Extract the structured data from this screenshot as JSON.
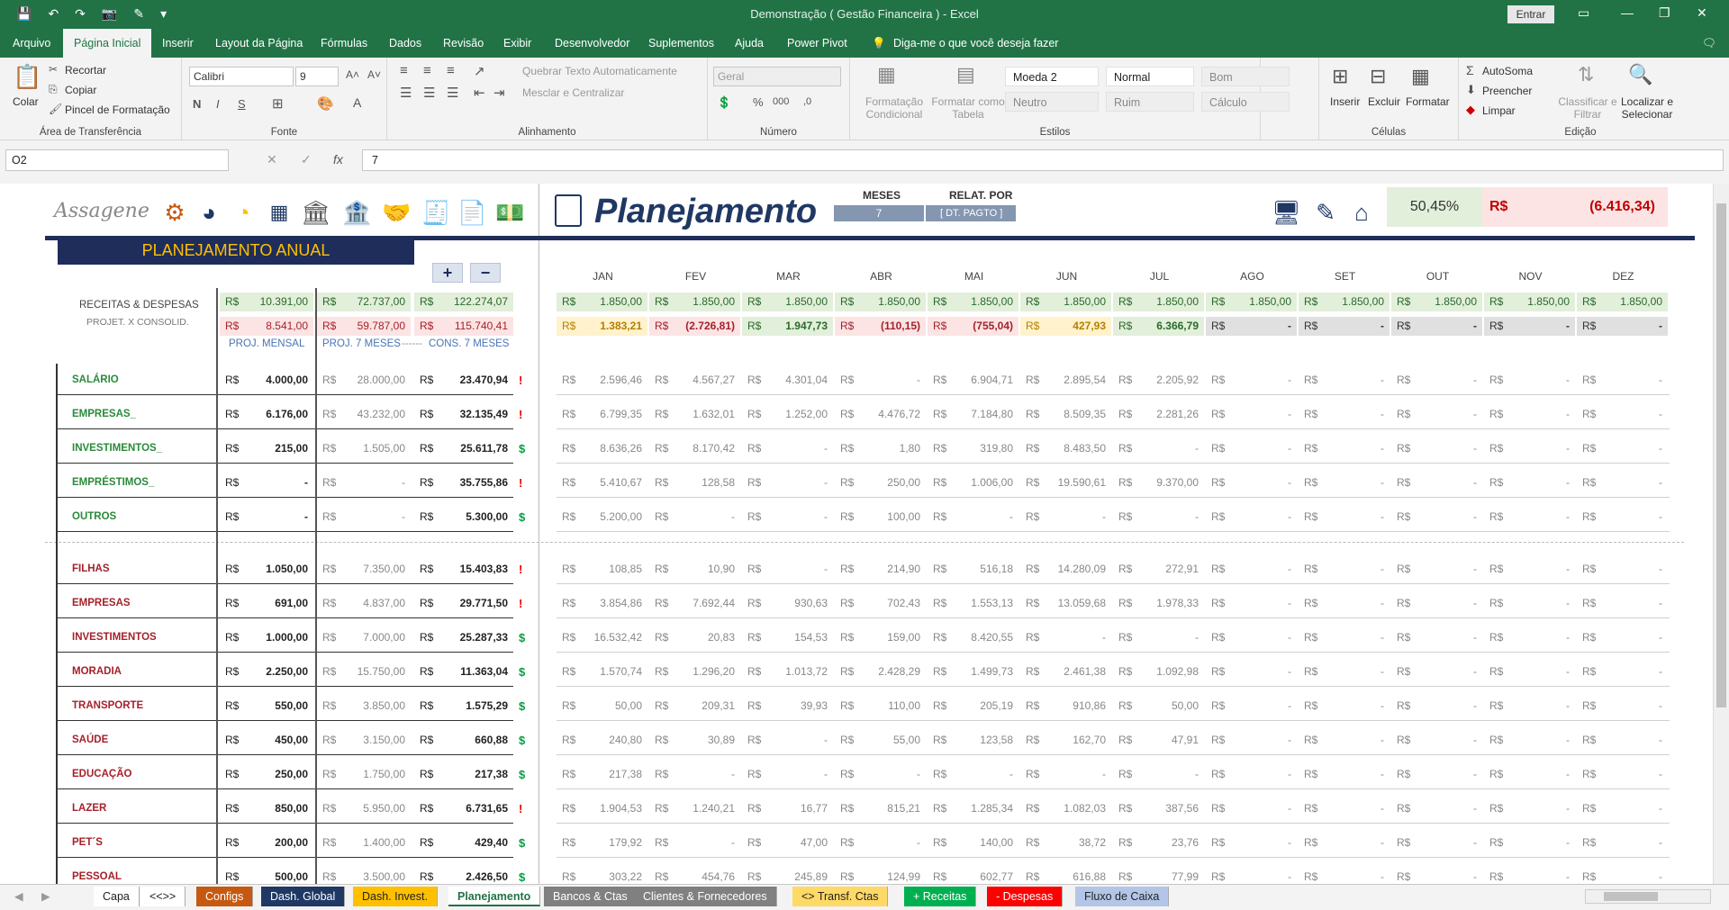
{
  "window": {
    "title": "Demonstração ( Gestão Financeira )  -  Excel",
    "signin": "Entrar"
  },
  "ribbon_tabs": [
    "Arquivo",
    "Página Inicial",
    "Inserir",
    "Layout da Página",
    "Fórmulas",
    "Dados",
    "Revisão",
    "Exibir",
    "Desenvolvedor",
    "Suplementos",
    "Ajuda",
    "Power Pivot"
  ],
  "tell_me": "Diga-me o que você deseja fazer",
  "ribbon": {
    "clipboard": {
      "paste": "Colar",
      "cut": "Recortar",
      "copy": "Copiar",
      "painter": "Pincel de Formatação",
      "label": "Área de Transferência"
    },
    "font": {
      "name": "Calibri",
      "size": "9",
      "label": "Fonte"
    },
    "align": {
      "wrap": "Quebrar Texto Automaticamente",
      "merge": "Mesclar e Centralizar",
      "label": "Alinhamento"
    },
    "number": {
      "format": "Geral",
      "label": "Número"
    },
    "styles": {
      "cond": "Formatação Condicional",
      "table": "Formatar como Tabela",
      "cells": [
        "Moeda 2",
        "Normal",
        "Bom",
        "Neutro",
        "Ruim",
        "Cálculo"
      ],
      "label": "Estilos"
    },
    "cells": {
      "insert": "Inserir",
      "delete": "Excluir",
      "format": "Formatar",
      "label": "Células"
    },
    "edit": {
      "autosum": "AutoSoma",
      "fill": "Preencher",
      "clear": "Limpar",
      "sort": "Classificar e Filtrar",
      "find": "Localizar e Selecionar",
      "label": "Edição"
    }
  },
  "formula_bar": {
    "cell": "O2",
    "value": "7"
  },
  "dashboard": {
    "logo": "Assagene",
    "title": "Planejamento",
    "meses_label": "MESES",
    "meses_value": "7",
    "relat_label": "RELAT. POR",
    "relat_value": "[ DT. PAGTO ]",
    "pct": "50,45%",
    "currency": "R$",
    "balance": "(6.416,34)",
    "panel_title": "PLANEJAMENTO ANUAL",
    "plus": "+",
    "minus": "−",
    "rd_label_1": "RECEITAS & DESPESAS",
    "rd_label_2": "PROJET. X CONSOLID.",
    "sub_labels": [
      "PROJ. MENSAL",
      "PROJ. 7 MESES",
      "------",
      "CONS. 7 MESES"
    ]
  },
  "months": [
    "JAN",
    "FEV",
    "MAR",
    "ABR",
    "MAI",
    "JUN",
    "JUL",
    "AGO",
    "SET",
    "OUT",
    "NOV",
    "DEZ"
  ],
  "summary": {
    "receitas": [
      "10.391,00",
      "72.737,00",
      "122.274,07"
    ],
    "despesas": [
      "8.541,00",
      "59.787,00",
      "115.740,41"
    ],
    "month_receitas": [
      "1.850,00",
      "1.850,00",
      "1.850,00",
      "1.850,00",
      "1.850,00",
      "1.850,00",
      "1.850,00",
      "1.850,00",
      "1.850,00",
      "1.850,00",
      "1.850,00",
      "1.850,00"
    ],
    "month_saldo": [
      "1.383,21",
      "(2.726,81)",
      "1.947,73",
      "(110,15)",
      "(755,04)",
      "427,93",
      "6.366,79",
      "-",
      "-",
      "-",
      "-",
      "-"
    ]
  },
  "rows": [
    {
      "label": "SALÁRIO",
      "type": "rec",
      "proj": "4.000,00",
      "proj7": "28.000,00",
      "cons7": "23.470,94",
      "flag": "!",
      "m": [
        "2.596,46",
        "4.567,27",
        "4.301,04",
        "-",
        "6.904,71",
        "2.895,54",
        "2.205,92",
        "-",
        "-",
        "-",
        "-",
        "-"
      ]
    },
    {
      "label": "EMPRESAS_",
      "type": "rec",
      "proj": "6.176,00",
      "proj7": "43.232,00",
      "cons7": "32.135,49",
      "flag": "!",
      "m": [
        "6.799,35",
        "1.632,01",
        "1.252,00",
        "4.476,72",
        "7.184,80",
        "8.509,35",
        "2.281,26",
        "-",
        "-",
        "-",
        "-",
        "-"
      ]
    },
    {
      "label": "INVESTIMENTOS_",
      "type": "rec",
      "proj": "215,00",
      "proj7": "1.505,00",
      "cons7": "25.611,78",
      "flag": "$",
      "m": [
        "8.636,26",
        "8.170,42",
        "-",
        "1,80",
        "319,80",
        "8.483,50",
        "-",
        "-",
        "-",
        "-",
        "-",
        "-"
      ]
    },
    {
      "label": "EMPRÉSTIMOS_",
      "type": "rec",
      "proj": "-",
      "proj7": "-",
      "cons7": "35.755,86",
      "flag": "!",
      "m": [
        "5.410,67",
        "128,58",
        "-",
        "250,00",
        "1.006,00",
        "19.590,61",
        "9.370,00",
        "-",
        "-",
        "-",
        "-",
        "-"
      ]
    },
    {
      "label": "OUTROS",
      "type": "rec",
      "proj": "-",
      "proj7": "-",
      "cons7": "5.300,00",
      "flag": "$",
      "m": [
        "5.200,00",
        "-",
        "-",
        "100,00",
        "-",
        "-",
        "-",
        "-",
        "-",
        "-",
        "-",
        "-"
      ]
    },
    {
      "label": "FILHAS",
      "type": "desp",
      "proj": "1.050,00",
      "proj7": "7.350,00",
      "cons7": "15.403,83",
      "flag": "!",
      "m": [
        "108,85",
        "10,90",
        "-",
        "214,90",
        "516,18",
        "14.280,09",
        "272,91",
        "-",
        "-",
        "-",
        "-",
        "-"
      ]
    },
    {
      "label": "EMPRESAS",
      "type": "desp",
      "proj": "691,00",
      "proj7": "4.837,00",
      "cons7": "29.771,50",
      "flag": "!",
      "m": [
        "3.854,86",
        "7.692,44",
        "930,63",
        "702,43",
        "1.553,13",
        "13.059,68",
        "1.978,33",
        "-",
        "-",
        "-",
        "-",
        "-"
      ]
    },
    {
      "label": "INVESTIMENTOS",
      "type": "desp",
      "proj": "1.000,00",
      "proj7": "7.000,00",
      "cons7": "25.287,33",
      "flag": "$",
      "m": [
        "16.532,42",
        "20,83",
        "154,53",
        "159,00",
        "8.420,55",
        "-",
        "-",
        "-",
        "-",
        "-",
        "-",
        "-"
      ]
    },
    {
      "label": "MORADIA",
      "type": "desp",
      "proj": "2.250,00",
      "proj7": "15.750,00",
      "cons7": "11.363,04",
      "flag": "$",
      "m": [
        "1.570,74",
        "1.296,20",
        "1.013,72",
        "2.428,29",
        "1.499,73",
        "2.461,38",
        "1.092,98",
        "-",
        "-",
        "-",
        "-",
        "-"
      ]
    },
    {
      "label": "TRANSPORTE",
      "type": "desp",
      "proj": "550,00",
      "proj7": "3.850,00",
      "cons7": "1.575,29",
      "flag": "$",
      "m": [
        "50,00",
        "209,31",
        "39,93",
        "110,00",
        "205,19",
        "910,86",
        "50,00",
        "-",
        "-",
        "-",
        "-",
        "-"
      ]
    },
    {
      "label": "SAÚDE",
      "type": "desp",
      "proj": "450,00",
      "proj7": "3.150,00",
      "cons7": "660,88",
      "flag": "$",
      "m": [
        "240,80",
        "30,89",
        "-",
        "55,00",
        "123,58",
        "162,70",
        "47,91",
        "-",
        "-",
        "-",
        "-",
        "-"
      ]
    },
    {
      "label": "EDUCAÇÃO",
      "type": "desp",
      "proj": "250,00",
      "proj7": "1.750,00",
      "cons7": "217,38",
      "flag": "$",
      "m": [
        "217,38",
        "-",
        "-",
        "-",
        "-",
        "-",
        "-",
        "-",
        "-",
        "-",
        "-",
        "-"
      ]
    },
    {
      "label": "LAZER",
      "type": "desp",
      "proj": "850,00",
      "proj7": "5.950,00",
      "cons7": "6.731,65",
      "flag": "!",
      "m": [
        "1.904,53",
        "1.240,21",
        "16,77",
        "815,21",
        "1.285,34",
        "1.082,03",
        "387,56",
        "-",
        "-",
        "-",
        "-",
        "-"
      ]
    },
    {
      "label": "PET´S",
      "type": "desp",
      "proj": "200,00",
      "proj7": "1.400,00",
      "cons7": "429,40",
      "flag": "$",
      "m": [
        "179,92",
        "-",
        "47,00",
        "-",
        "140,00",
        "38,72",
        "23,76",
        "-",
        "-",
        "-",
        "-",
        "-"
      ]
    },
    {
      "label": "PESSOAL",
      "type": "desp",
      "proj": "500,00",
      "proj7": "3.500,00",
      "cons7": "2.426,50",
      "flag": "$",
      "m": [
        "303,22",
        "454,76",
        "245,89",
        "124,99",
        "602,77",
        "616,88",
        "77,99",
        "-",
        "-",
        "-",
        "-",
        "-"
      ]
    }
  ],
  "sheet_tabs": [
    {
      "label": "Capa",
      "bg": "#ffffff",
      "fg": "#222222"
    },
    {
      "label": "<<>>",
      "bg": "#ffffff",
      "fg": "#222222"
    },
    {
      "label": "Configs",
      "bg": "#c65911",
      "fg": "#ffffff"
    },
    {
      "label": "Dash. Global",
      "bg": "#1f3864",
      "fg": "#ffffff"
    },
    {
      "label": "Dash. Invest.",
      "bg": "#ffc000",
      "fg": "#222222"
    },
    {
      "label": "Planejamento",
      "bg": "#ffffff",
      "fg": "#217346"
    },
    {
      "label": "Bancos & Ctas",
      "bg": "#808080",
      "fg": "#ffffff"
    },
    {
      "label": "Clientes & Fornecedores",
      "bg": "#808080",
      "fg": "#ffffff"
    },
    {
      "label": "<> Transf. Ctas",
      "bg": "#ffd966",
      "fg": "#222222"
    },
    {
      "label": "+ Receitas",
      "bg": "#00b050",
      "fg": "#ffffff"
    },
    {
      "label": "- Despesas",
      "bg": "#ff0000",
      "fg": "#ffffff"
    },
    {
      "label": "Fluxo de Caixa",
      "bg": "#b4c6e7",
      "fg": "#222222"
    }
  ]
}
